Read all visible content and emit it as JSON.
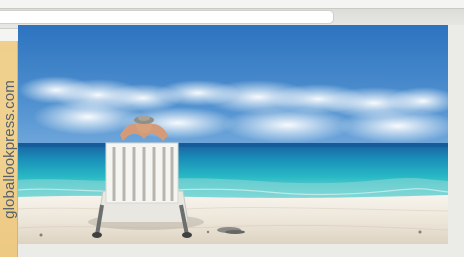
{
  "credit": {
    "text": "globallookpress.com"
  },
  "colors": {
    "sky": "#4f90cf",
    "sea": "#27b6c4",
    "sand": "#eee8dc",
    "credit_strip": "#efcf8b"
  }
}
